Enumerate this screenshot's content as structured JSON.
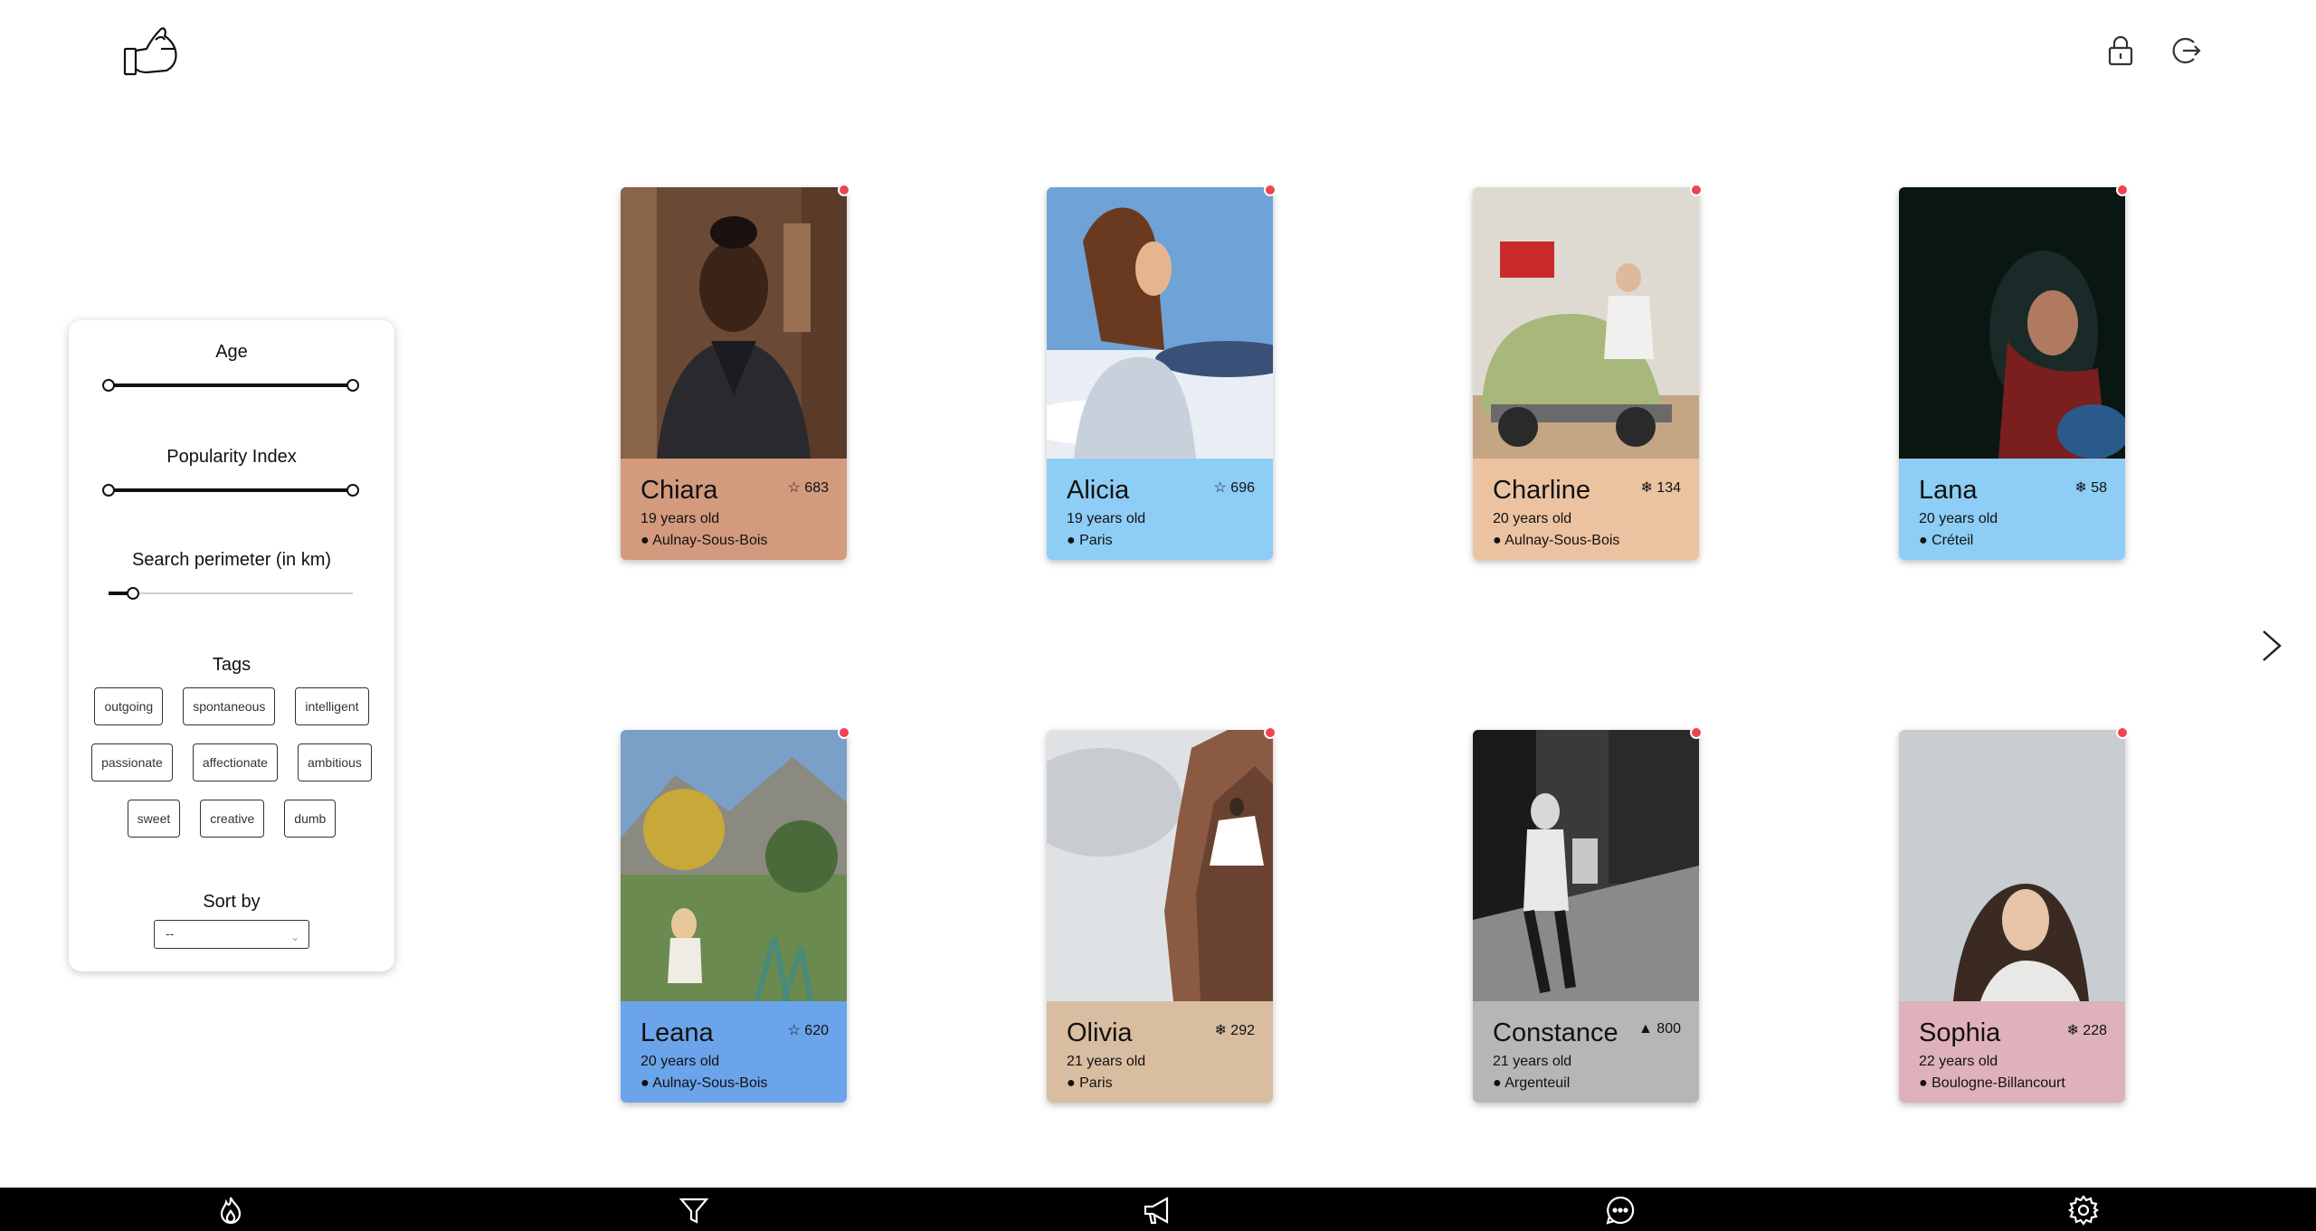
{
  "header": {
    "logo_icon": "thumbs-up-icon",
    "lock_icon": "lock-icon",
    "logout_icon": "logout-icon"
  },
  "filters": {
    "age_label": "Age",
    "age_range": [
      0,
      1
    ],
    "popularity_label": "Popularity Index",
    "popularity_range": [
      0,
      1
    ],
    "perimeter_label": "Search perimeter (in km)",
    "perimeter_value": 0.1,
    "tags_label": "Tags",
    "tags": [
      [
        "outgoing",
        "spontaneous",
        "intelligent"
      ],
      [
        "passionate",
        "affectionate",
        "ambitious"
      ],
      [
        "sweet",
        "creative",
        "dumb"
      ]
    ],
    "sort_label": "Sort by",
    "sort_value": "--"
  },
  "cards": [
    {
      "name": "Chiara",
      "age": "19 years old",
      "city": "Aulnay-Sous-Bois",
      "score": "683",
      "score_icon": "star-half-icon",
      "color": "#d49a7e"
    },
    {
      "name": "Alicia",
      "age": "19 years old",
      "city": "Paris",
      "score": "696",
      "score_icon": "star-half-icon",
      "color": "#8ecdf5"
    },
    {
      "name": "Charline",
      "age": "20 years old",
      "city": "Aulnay-Sous-Bois",
      "score": "134",
      "score_icon": "snowflake-icon",
      "color": "#ecc3a1"
    },
    {
      "name": "Lana",
      "age": "20 years old",
      "city": "Créteil",
      "score": "58",
      "score_icon": "snowflake-icon",
      "color": "#8ecdf5"
    },
    {
      "name": "Leana",
      "age": "20 years old",
      "city": "Aulnay-Sous-Bois",
      "score": "620",
      "score_icon": "star-half-icon",
      "color": "#6ba4ea"
    },
    {
      "name": "Olivia",
      "age": "21 years old",
      "city": "Paris",
      "score": "292",
      "score_icon": "snowflake-icon",
      "color": "#d9bda0"
    },
    {
      "name": "Constance",
      "age": "21 years old",
      "city": "Argenteuil",
      "score": "800",
      "score_icon": "flame-icon",
      "color": "#b6b6b6"
    },
    {
      "name": "Sophia",
      "age": "22 years old",
      "city": "Boulogne-Billancourt",
      "score": "228",
      "score_icon": "snowflake-icon",
      "color": "#dfb1bb"
    }
  ],
  "bottom_nav": [
    "flame-icon",
    "filter-icon",
    "megaphone-icon",
    "chat-icon",
    "settings-icon"
  ],
  "colors": {
    "notification_dot": "#ee4455",
    "bottom_bar": "#000000"
  }
}
